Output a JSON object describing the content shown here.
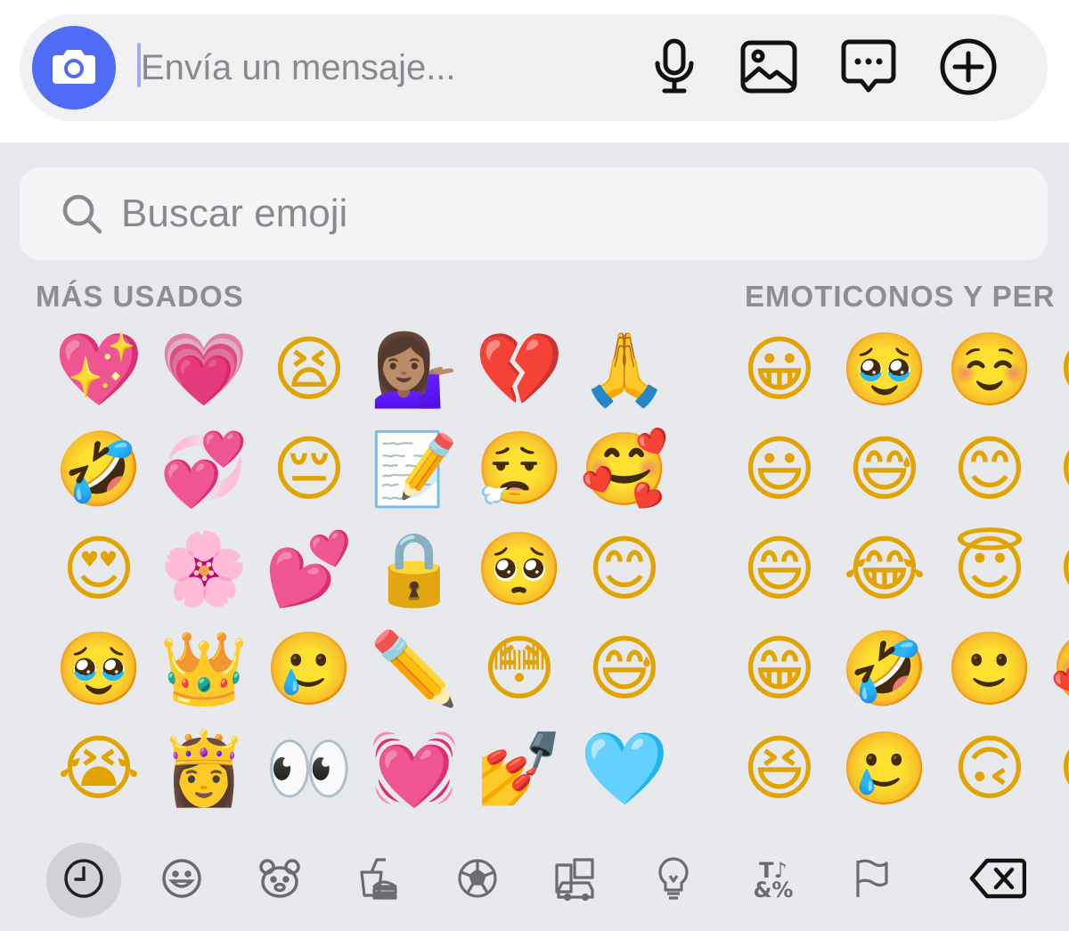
{
  "composer": {
    "placeholder": "Envía un mensaje...",
    "icons": [
      "camera-icon",
      "microphone-icon",
      "image-icon",
      "message-more-icon",
      "plus-circle-icon"
    ]
  },
  "search": {
    "placeholder": "Buscar emoji"
  },
  "sections": {
    "most_used": "MÁS USADOS",
    "smileys": "EMOTICONOS Y PER"
  },
  "most_used_rows": [
    [
      "💖",
      "💗",
      "😫",
      "💁🏽‍♀️",
      "💔",
      "🙏"
    ],
    [
      "🤣",
      "💞",
      "😔",
      "📝",
      "😮‍💨",
      "🥰"
    ],
    [
      "😍",
      "🌸",
      "💕",
      "🔒",
      "🥺",
      "😊"
    ],
    [
      "🥹",
      "👑",
      "🥲",
      "✏️",
      "😳",
      "😅"
    ],
    [
      "😭",
      "👸",
      "👀",
      "💓",
      "💅",
      "🩵"
    ]
  ],
  "smiley_rows": [
    [
      "😀",
      "🥹",
      "☺️",
      "😍"
    ],
    [
      "😃",
      "😅",
      "😊",
      "😘"
    ],
    [
      "😄",
      "😂",
      "😇",
      "😍"
    ],
    [
      "😁",
      "🤣",
      "🙂",
      "🥰"
    ],
    [
      "😆",
      "🥲",
      "🙃",
      "😚"
    ]
  ],
  "categories": [
    {
      "name": "recents-icon",
      "active": true
    },
    {
      "name": "smiley-icon"
    },
    {
      "name": "animal-icon"
    },
    {
      "name": "food-icon"
    },
    {
      "name": "activity-icon"
    },
    {
      "name": "travel-icon"
    },
    {
      "name": "objects-icon"
    },
    {
      "name": "symbols-icon"
    },
    {
      "name": "flag-icon"
    },
    {
      "name": "delete-icon"
    }
  ],
  "colors": {
    "accent": "#4e6cf6",
    "keyboard_bg": "#e8e9ed",
    "section_text": "#8d8e93"
  }
}
